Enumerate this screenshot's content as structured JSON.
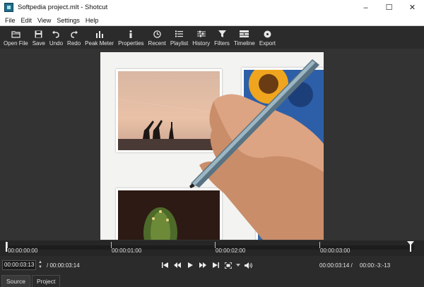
{
  "window": {
    "title": "Softpedia project.mlt - Shotcut",
    "minimize": "–",
    "maximize": "☐",
    "close": "✕"
  },
  "menu": [
    "File",
    "Edit",
    "View",
    "Settings",
    "Help"
  ],
  "toolbar": [
    {
      "label": "Open File",
      "icon": "folder-open-icon"
    },
    {
      "label": "Save",
      "icon": "save-icon"
    },
    {
      "label": "Undo",
      "icon": "undo-icon"
    },
    {
      "label": "Redo",
      "icon": "redo-icon"
    },
    {
      "label": "Peak Meter",
      "icon": "peak-meter-icon"
    },
    {
      "label": "Properties",
      "icon": "info-icon"
    },
    {
      "label": "Recent",
      "icon": "clock-icon"
    },
    {
      "label": "Playlist",
      "icon": "list-icon"
    },
    {
      "label": "History",
      "icon": "history-icon"
    },
    {
      "label": "Filters",
      "icon": "funnel-icon"
    },
    {
      "label": "Timeline",
      "icon": "timeline-icon"
    },
    {
      "label": "Export",
      "icon": "disc-icon"
    }
  ],
  "ruler": {
    "ticks": [
      "00:00:00:00",
      "00:00:01:00",
      "00:00:02:00",
      "00:00:03:00"
    ]
  },
  "transport": {
    "current_timecode": "00:00:03:13",
    "total_duration": "/ 00:00:03:14",
    "in_point": "00:00:03:14 /",
    "out_point": "00:00:-3:-13"
  },
  "tabs": [
    "Source",
    "Project"
  ],
  "colors": {
    "accent": "#1f6f8b",
    "background": "#2f2f2f",
    "toolbar": "#2b2b2b"
  }
}
